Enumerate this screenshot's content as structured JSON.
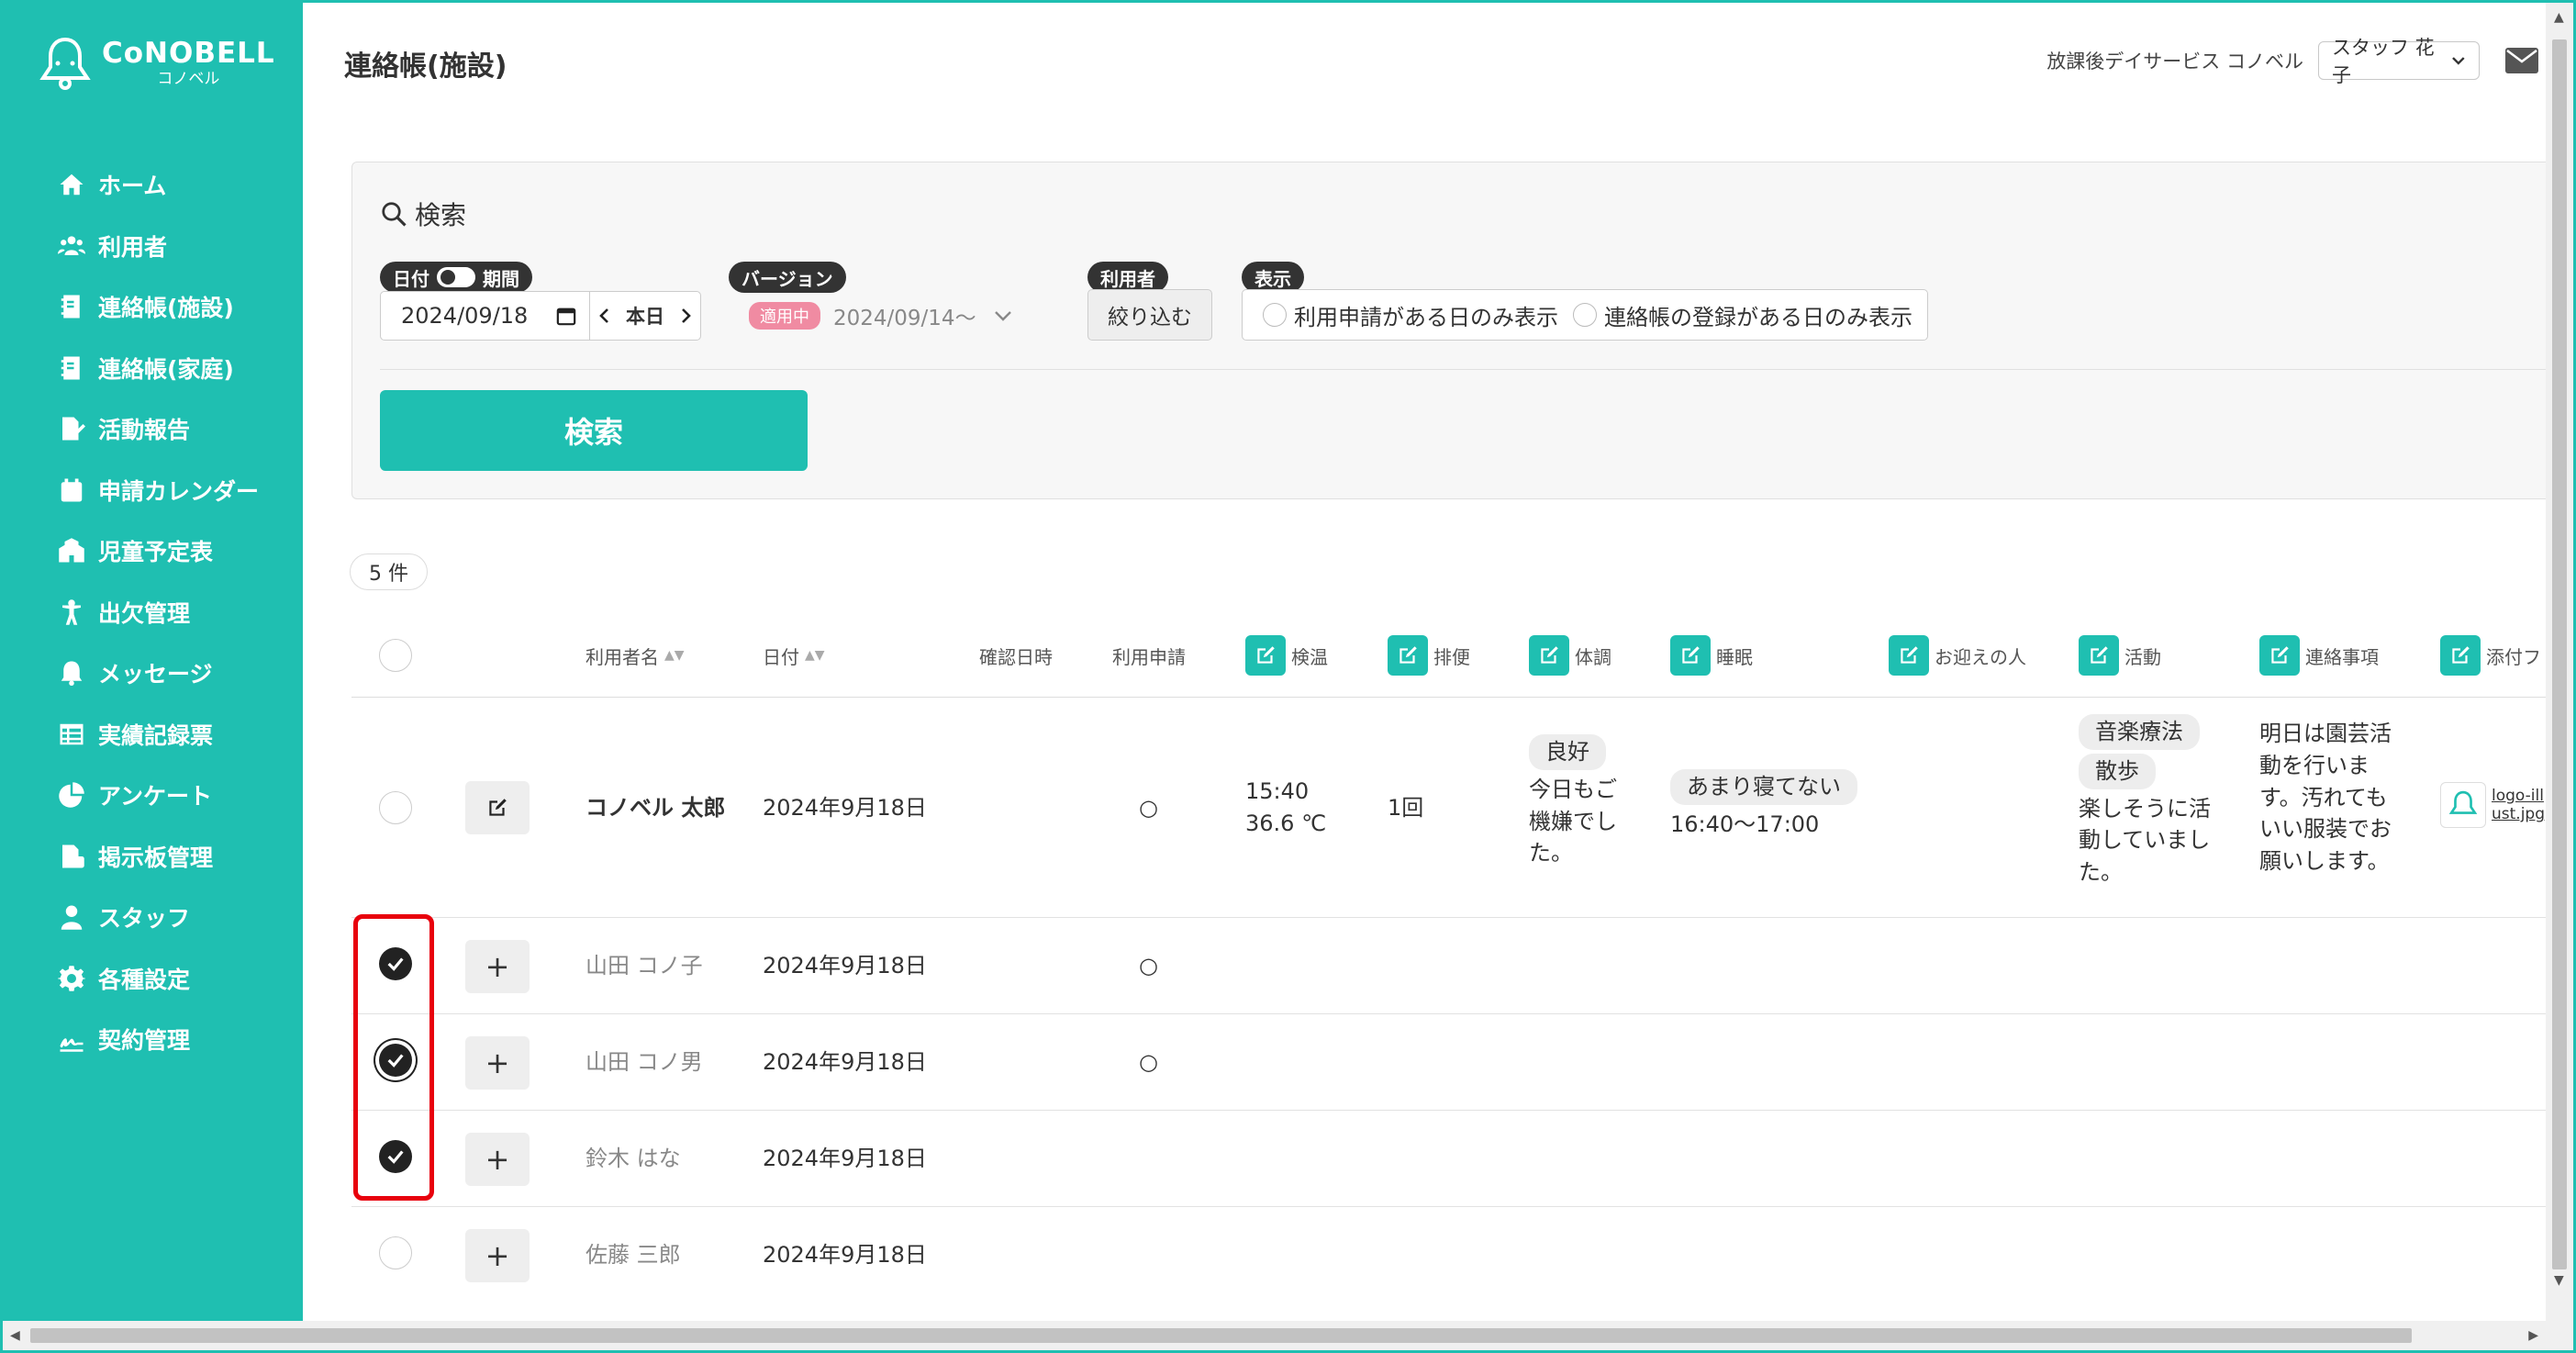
{
  "logo": {
    "main": "CoNOBELL",
    "sub": "コノベル"
  },
  "sidebar": {
    "items": [
      {
        "label": "ホーム",
        "icon": "home-icon"
      },
      {
        "label": "利用者",
        "icon": "users-icon"
      },
      {
        "label": "連絡帳(施設)",
        "icon": "notebook-icon"
      },
      {
        "label": "連絡帳(家庭)",
        "icon": "notebook-icon"
      },
      {
        "label": "活動報告",
        "icon": "report-icon"
      },
      {
        "label": "申請カレンダー",
        "icon": "calendar-icon"
      },
      {
        "label": "児童予定表",
        "icon": "school-icon"
      },
      {
        "label": "出欠管理",
        "icon": "person-icon"
      },
      {
        "label": "メッセージ",
        "icon": "bell-icon"
      },
      {
        "label": "実績記録票",
        "icon": "table-icon"
      },
      {
        "label": "アンケート",
        "icon": "pie-icon"
      },
      {
        "label": "掲示板管理",
        "icon": "board-icon"
      },
      {
        "label": "スタッフ",
        "icon": "staff-icon"
      },
      {
        "label": "各種設定",
        "icon": "gear-icon"
      },
      {
        "label": "契約管理",
        "icon": "contract-icon"
      }
    ]
  },
  "header": {
    "title": "連絡帳(施設)",
    "facility": "放課後デイサービス コノベル",
    "staff": "スタッフ 花子"
  },
  "search": {
    "heading": "検索",
    "date_label_left": "日付",
    "date_label_right": "期間",
    "date_value": "2024/09/18",
    "today_label": "本日",
    "version_label": "バージョン",
    "version_badge": "適用中",
    "version_value": "2024/09/14〜",
    "user_label": "利用者",
    "filter_button": "絞り込む",
    "display_label": "表示",
    "display_option_1": "利用申請がある日のみ表示",
    "display_option_2": "連絡帳の登録がある日のみ表示",
    "search_button": "検索"
  },
  "results": {
    "count": "5 件"
  },
  "table": {
    "headers": {
      "name": "利用者名",
      "date": "日付",
      "confirm": "確認日時",
      "application": "利用申請",
      "temperature": "検温",
      "bowel": "排便",
      "condition": "体調",
      "sleep": "睡眠",
      "pickup": "お迎えの人",
      "activity": "活動",
      "notes": "連絡事項",
      "attachment": "添付フ"
    },
    "rows": [
      {
        "name": "コノベル 太郎",
        "date": "2024年9月18日",
        "application": "○",
        "temp_time": "15:40",
        "temp_value": "36.6 ℃",
        "bowel": "1回",
        "condition_tag": "良好",
        "condition_text": "今日もご機嫌でした。",
        "sleep_tag": "あまり寝てない",
        "sleep_time": "16:40〜17:00",
        "activity_tag_1": "音楽療法",
        "activity_tag_2": "散歩",
        "activity_text": "楽しそうに活動していました。",
        "notes": "明日は園芸活動を行います。汚れてもいい服装でお願いします。",
        "attachment": "logo-illust.jpg",
        "checked": false
      },
      {
        "name": "山田 コノ子",
        "date": "2024年9月18日",
        "application": "○",
        "checked": true
      },
      {
        "name": "山田 コノ男",
        "date": "2024年9月18日",
        "application": "○",
        "checked": true
      },
      {
        "name": "鈴木 はな",
        "date": "2024年9月18日",
        "application": "",
        "checked": true
      },
      {
        "name": "佐藤 三郎",
        "date": "2024年9月18日",
        "application": "",
        "checked": false
      }
    ]
  },
  "colors": {
    "accent": "#1fbfb1",
    "highlight": "#e8000c",
    "badge": "#f08ba2"
  }
}
